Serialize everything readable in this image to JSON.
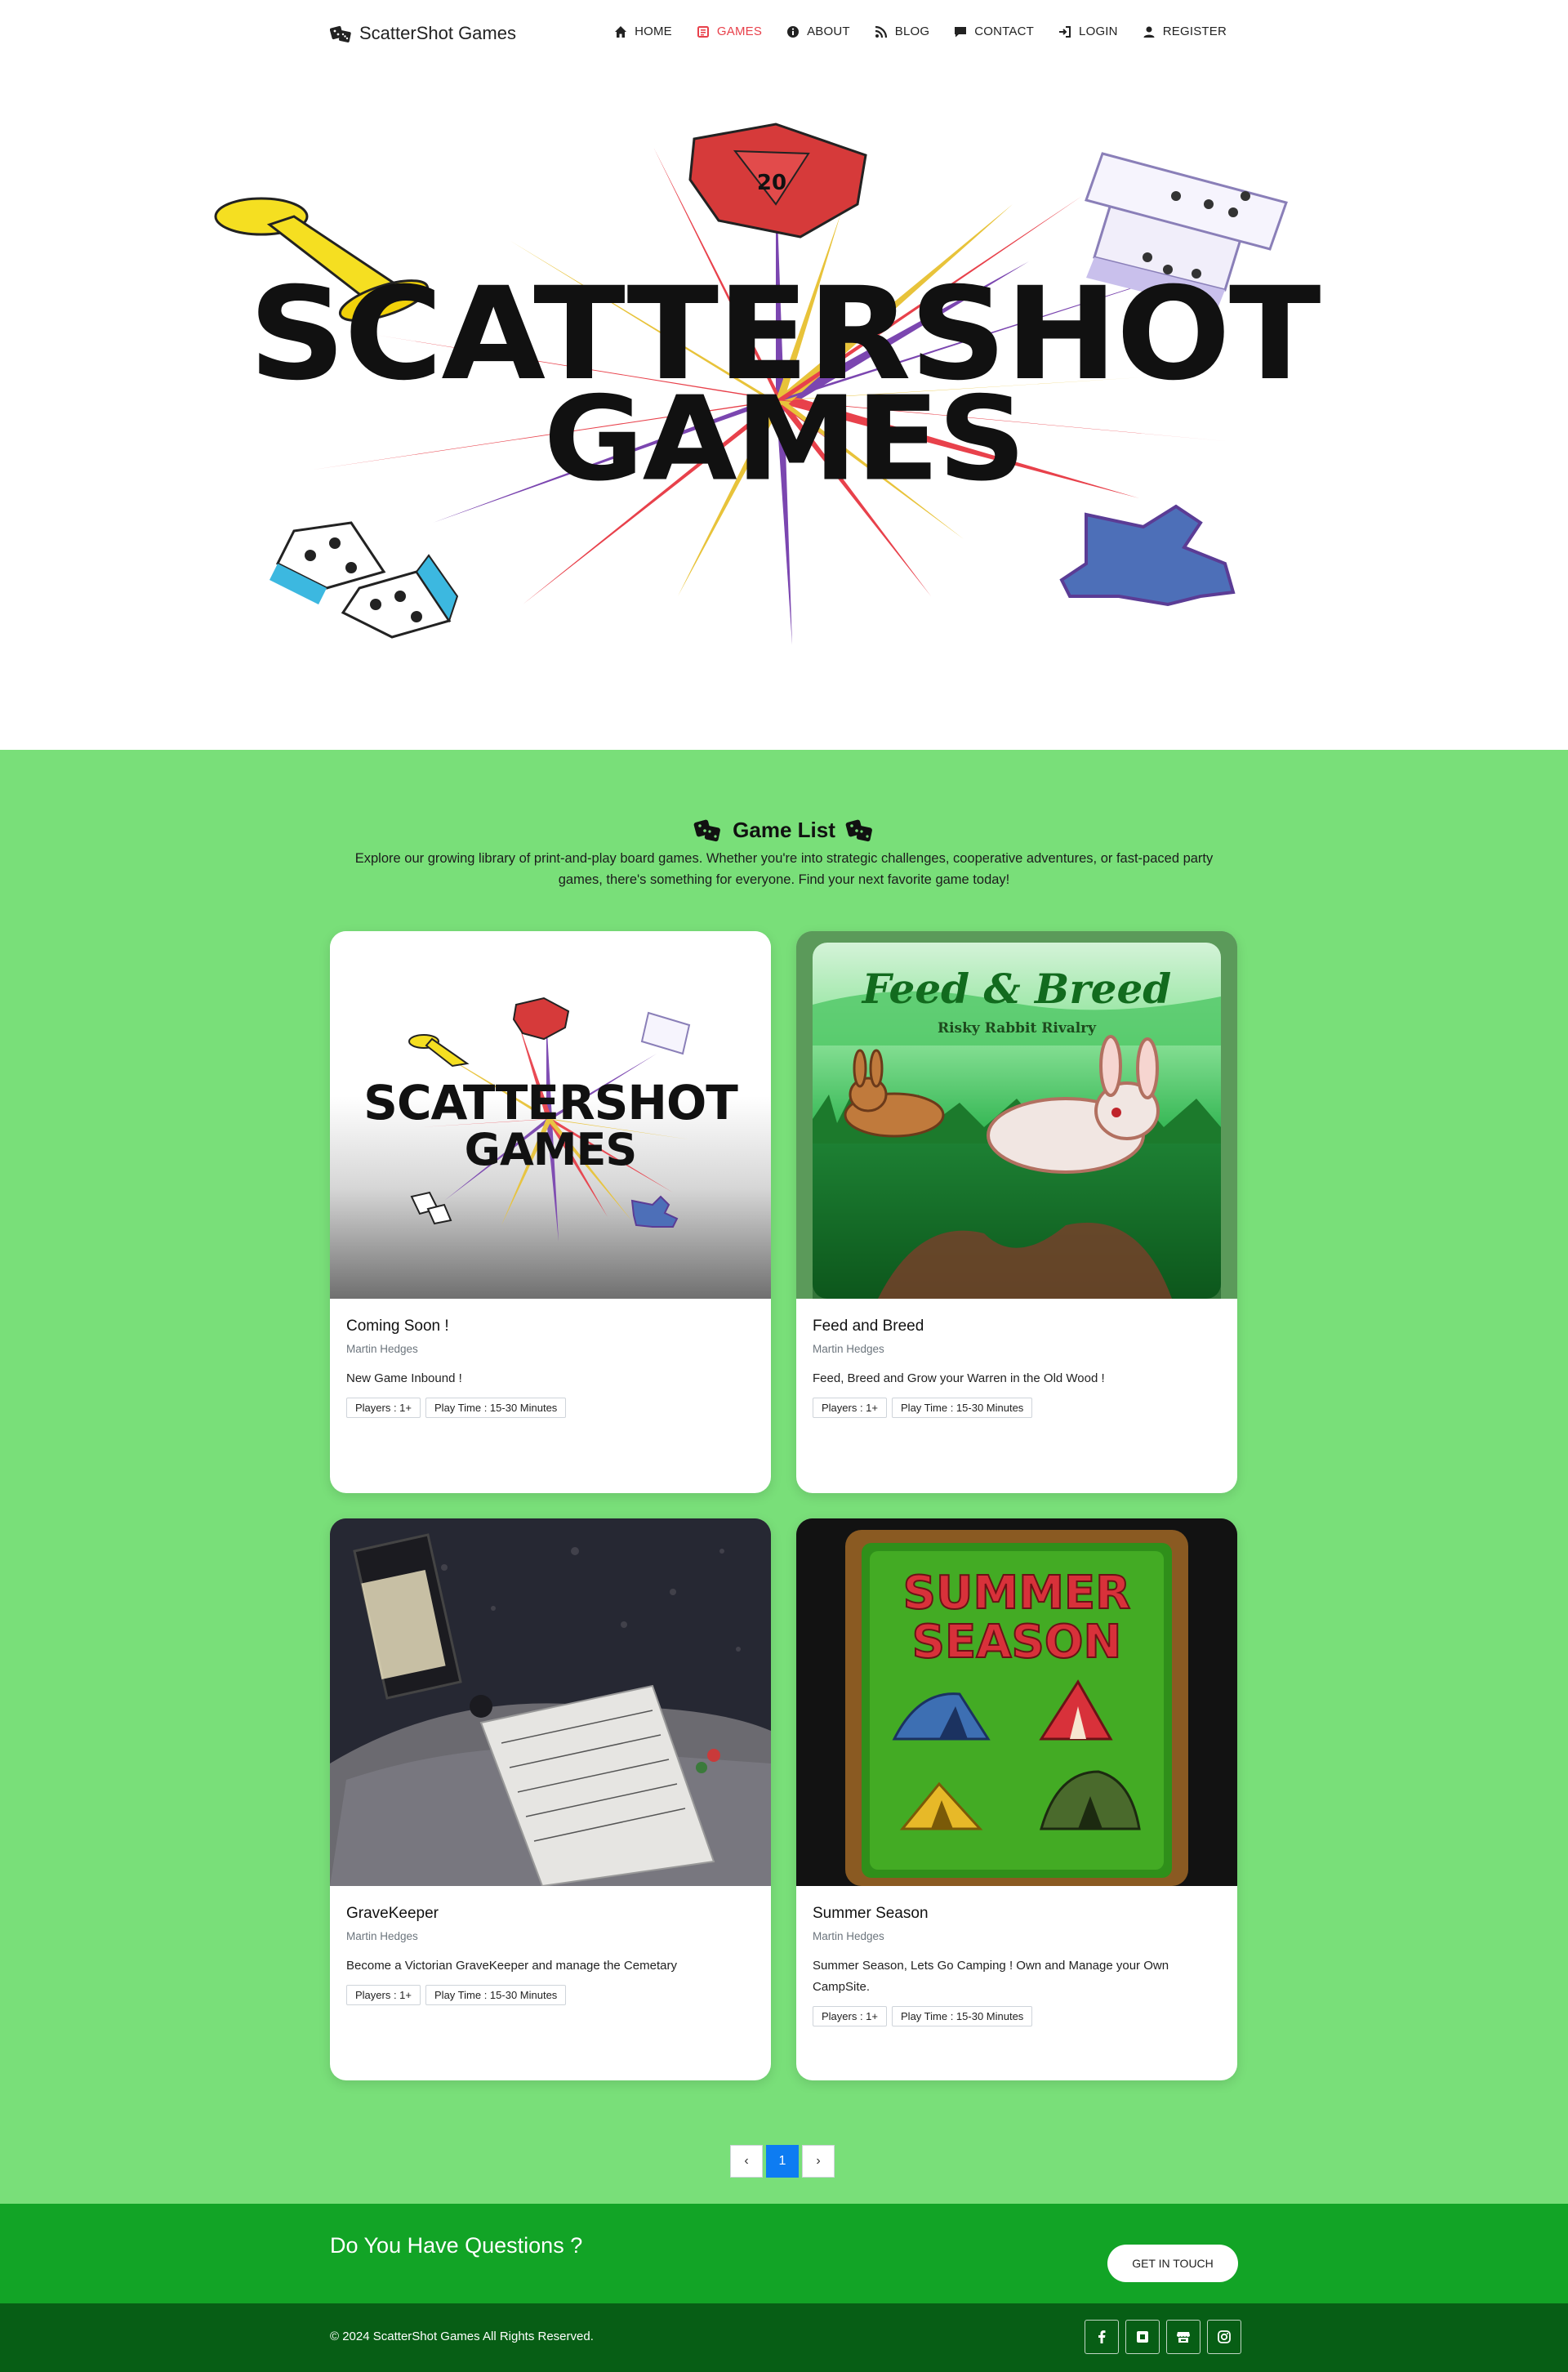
{
  "brand": {
    "name": "ScatterShot Games",
    "icon": "dice-icon"
  },
  "nav": [
    {
      "label": "HOME",
      "icon": "home-icon",
      "active": false
    },
    {
      "label": "GAMES",
      "icon": "games-icon",
      "active": true
    },
    {
      "label": "ABOUT",
      "icon": "info-icon",
      "active": false
    },
    {
      "label": "BLOG",
      "icon": "rss-icon",
      "active": false
    },
    {
      "label": "CONTACT",
      "icon": "comment-icon",
      "active": false
    },
    {
      "label": "LOGIN",
      "icon": "login-icon",
      "active": false
    },
    {
      "label": "REGISTER",
      "icon": "user-icon",
      "active": false
    }
  ],
  "hero": {
    "logo_line1": "SCATTERSHOT",
    "logo_line2": "GAMES",
    "die_number": "20"
  },
  "game_list": {
    "title": "Game List",
    "description": "Explore our growing library of print-and-play board games. Whether you're into strategic challenges, cooperative adventures, or fast-paced party games, there's something for everyone. Find your next favorite game today!"
  },
  "cards": [
    {
      "title": "Coming Soon !",
      "author": "Martin Hedges",
      "description": "New Game Inbound !",
      "players": "Players : 1+",
      "playtime": "Play Time : 15-30 Minutes",
      "image": {
        "line1": "SCATTERSHOT",
        "line2": "GAMES"
      }
    },
    {
      "title": "Feed and Breed",
      "author": "Martin Hedges",
      "description": "Feed, Breed and Grow your Warren in the Old Wood !",
      "players": "Players : 1+",
      "playtime": "Play Time : 15-30 Minutes",
      "image": {
        "title": "Feed & Breed",
        "subtitle": "Risky Rabbit Rivalry"
      }
    },
    {
      "title": "GraveKeeper",
      "author": "Martin Hedges",
      "description": "Become a Victorian GraveKeeper and manage the Cemetary",
      "players": "Players : 1+",
      "playtime": "Play Time : 15-30 Minutes",
      "image": {}
    },
    {
      "title": "Summer Season",
      "author": "Martin Hedges",
      "description": "Summer Season, Lets Go Camping ! Own and Manage your Own CampSite.",
      "players": "Players : 1+",
      "playtime": "Play Time : 15-30 Minutes",
      "image": {
        "line1": "SUMMER",
        "line2": "SEASON"
      }
    }
  ],
  "pagination": {
    "prev": "‹",
    "current": "1",
    "next": "›"
  },
  "cta": {
    "text": "Do You Have Questions ?",
    "button": "GET IN TOUCH"
  },
  "footer": {
    "copyright": "© 2024 ScatterShot Games All Rights Reserved.",
    "socials": [
      "facebook-icon",
      "square-icon",
      "store-icon",
      "instagram-icon"
    ]
  },
  "colors": {
    "games_bg": "#79df79",
    "cta_bg": "#12a426",
    "footer_bg": "#075e15",
    "active_nav": "#e8414b",
    "active_page": "#0d7cf2"
  }
}
